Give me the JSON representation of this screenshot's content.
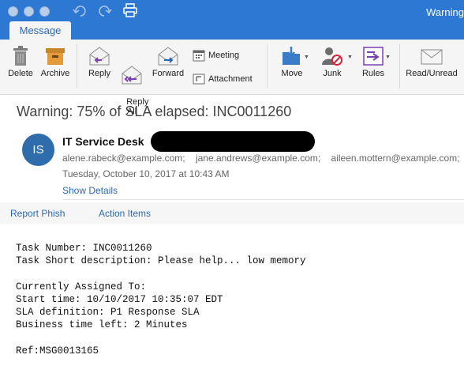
{
  "window": {
    "title": "Warning",
    "tab": "Message"
  },
  "ribbon": {
    "delete": "Delete",
    "archive": "Archive",
    "reply": "Reply",
    "reply_all": "Reply\nAll",
    "forward": "Forward",
    "meeting": "Meeting",
    "attachment": "Attachment",
    "move": "Move",
    "junk": "Junk",
    "rules": "Rules",
    "read_unread": "Read/Unread"
  },
  "message": {
    "subject": "Warning: 75% of SLA elapsed: INC0011260",
    "avatar_initials": "IS",
    "sender": "IT Service Desk",
    "recipients": [
      "alene.rabeck@example.com;",
      "jane.andrews@example.com;",
      "aileen.mottern@example.com;"
    ],
    "date": "Tuesday, October 10, 2017 at 10:43 AM",
    "show_details": "Show Details"
  },
  "addins": {
    "report_phish": "Report Phish",
    "action_items": "Action Items"
  },
  "body_lines": [
    "Task Number: INC0011260",
    "Task Short description: Please help... low memory",
    "",
    "Currently Assigned To:",
    "Start time: 10/10/2017 10:35:07 EDT",
    "SLA definition: P1 Response SLA",
    "Business time left: 2 Minutes",
    "",
    "Ref:MSG0013165"
  ],
  "colors": {
    "titlebar": "#2d78d2",
    "accent": "#2b69b7",
    "avatar": "#2f6cab"
  }
}
